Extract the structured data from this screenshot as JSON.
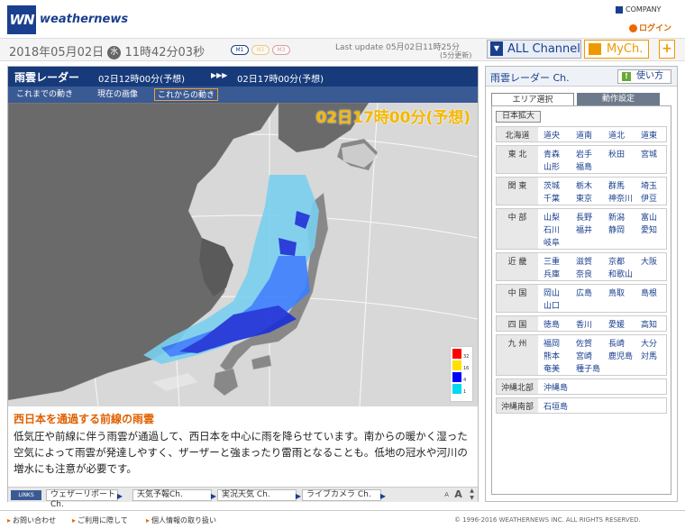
{
  "header": {
    "logo_text": "WN",
    "brand": "weathernews",
    "company": "COMPANY",
    "login": "ログイン"
  },
  "datebar": {
    "date": "2018年05月02日",
    "dow": "水",
    "time": "11時42分03秒",
    "mode_buttons": [
      "M1",
      "M2",
      "M3"
    ],
    "last_update_label": "Last update 05月02日11時25分",
    "update_interval": "(5分更新)"
  },
  "channels": {
    "all": "ALL Channel",
    "mych": "MyCh.",
    "add": "+"
  },
  "radar": {
    "title": "雨雲レーダー",
    "range_start": "02日12時00分(予想)",
    "arrows": "▶▶▶",
    "range_end": "02日17時00分(予想)",
    "buttons": [
      "これまでの動き",
      "現在の画像",
      "これからの動き"
    ],
    "current_time": "02日17時00分(予想)",
    "legend_values": [
      "32",
      "16",
      "4",
      "1"
    ],
    "legend_colors": [
      "#ff0000",
      "#ffe000",
      "#0000ff",
      "#00d8f0"
    ]
  },
  "article": {
    "headline": "西日本を通過する前線の雨雲",
    "body": "低気圧や前線に伴う雨雲が通過して、西日本を中心に雨を降らせています。南からの暖かく湿った空気によって雨雲が発達しやすく、ザーザーと強まったり雷雨となることも。低地の冠水や河川の増水にも注意が必要です。"
  },
  "links": {
    "label": "LINKS",
    "items": [
      "ウェザーリポートCh.",
      "天気予報Ch.",
      "実況天気 Ch.",
      "ライブカメラ Ch."
    ],
    "controls": [
      "A",
      "A",
      "▲",
      "▼"
    ]
  },
  "sidebar": {
    "title": "雨雲レーダー Ch.",
    "howto": "使い方",
    "tabs": [
      "エリア選択",
      "動作設定"
    ],
    "zoom": "日本拡大",
    "regions": [
      {
        "name": "北海道",
        "prefs": [
          "道央",
          "道南",
          "道北",
          "道東"
        ]
      },
      {
        "name": "東 北",
        "prefs": [
          "青森",
          "岩手",
          "秋田",
          "宮城",
          "山形",
          "福島"
        ]
      },
      {
        "name": "関 東",
        "prefs": [
          "茨城",
          "栃木",
          "群馬",
          "埼玉",
          "千葉",
          "東京",
          "神奈川",
          "伊豆"
        ]
      },
      {
        "name": "中 部",
        "prefs": [
          "山梨",
          "長野",
          "新潟",
          "富山",
          "石川",
          "福井",
          "静岡",
          "愛知",
          "岐阜"
        ]
      },
      {
        "name": "近 畿",
        "prefs": [
          "三重",
          "滋賀",
          "京都",
          "大阪",
          "兵庫",
          "奈良",
          "和歌山"
        ]
      },
      {
        "name": "中 国",
        "prefs": [
          "岡山",
          "広島",
          "鳥取",
          "島根",
          "山口"
        ]
      },
      {
        "name": "四 国",
        "prefs": [
          "徳島",
          "香川",
          "愛媛",
          "高知"
        ]
      },
      {
        "name": "九 州",
        "prefs": [
          "福岡",
          "佐賀",
          "長崎",
          "大分",
          "熊本",
          "宮崎",
          "鹿児島",
          "対馬",
          "奄美",
          "種子島"
        ]
      },
      {
        "name": "沖縄北部",
        "prefs": [
          "沖縄島"
        ]
      },
      {
        "name": "沖縄南部",
        "prefs": [
          "石垣島"
        ]
      }
    ]
  },
  "footer": {
    "links": [
      "お問い合わせ",
      "ご利用に際して",
      "個人情報の取り扱い"
    ],
    "copyright": "© 1996-2016 WEATHERNEWS INC. ALL RIGHTS RESERVED."
  }
}
